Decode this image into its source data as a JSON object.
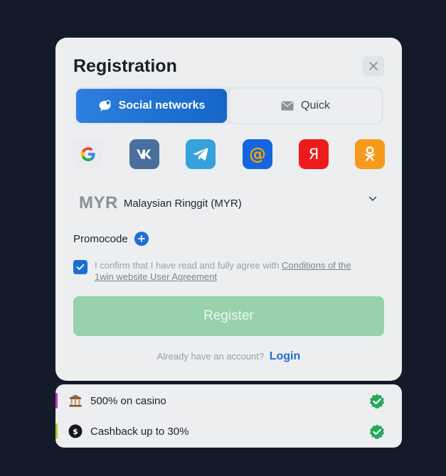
{
  "modal": {
    "title": "Registration",
    "close_icon": "close-icon"
  },
  "tabs": [
    {
      "label": "Social networks",
      "icon": "chat-bubble-icon",
      "active": true
    },
    {
      "label": "Quick",
      "icon": "envelope-icon",
      "active": false
    }
  ],
  "socials": [
    {
      "name": "google",
      "glyph": "G",
      "bg": "#eceef0",
      "fg": "#4285f4"
    },
    {
      "name": "vk",
      "glyph": "VK",
      "bg": "#4c75a3",
      "fg": "#ffffff"
    },
    {
      "name": "telegram",
      "glyph": "telegram",
      "bg": "#34a3dc",
      "fg": "#ffffff"
    },
    {
      "name": "mail",
      "glyph": "@",
      "bg": "#1565e0",
      "fg": "#f7a400"
    },
    {
      "name": "yandex",
      "glyph": "Я",
      "bg": "#ef1b1b",
      "fg": "#ffffff"
    },
    {
      "name": "odnoklassniki",
      "glyph": "ok",
      "bg": "#f59a1b",
      "fg": "#ffffff"
    }
  ],
  "currency": {
    "code": "MYR",
    "name": "Malaysian Ringgit (MYR)"
  },
  "promo": {
    "label": "Promocode"
  },
  "agreement": {
    "checked": true,
    "text": "I confirm that I have read and fully agree with ",
    "link": "Conditions of the 1win website User Agreement"
  },
  "register": {
    "label": "Register"
  },
  "login": {
    "prompt": "Already have an account?",
    "link": "Login"
  },
  "bonuses": [
    {
      "text": "500% on casino",
      "icon": "casino-icon",
      "accent": "#c535c8"
    },
    {
      "text": "Cashback up to 30%",
      "icon": "cashback-icon",
      "accent": "#a7d018"
    }
  ],
  "colors": {
    "primary_blue": "#1665c8",
    "register_green": "#97d2ad",
    "check_green": "#26a95a",
    "background": "#151a2b"
  }
}
